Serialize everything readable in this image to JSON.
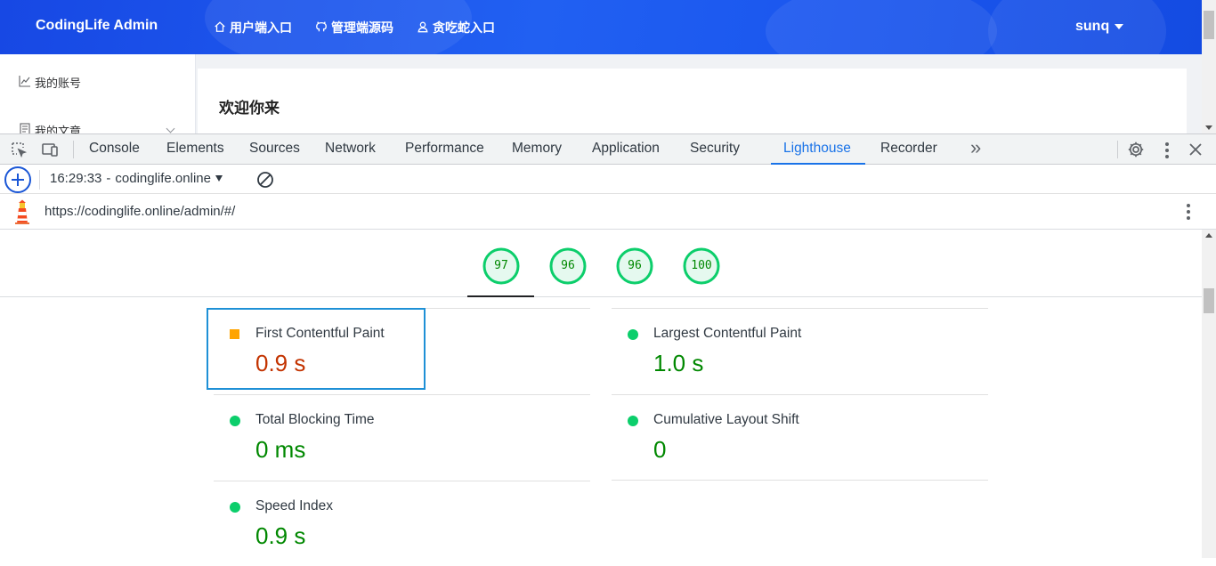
{
  "app": {
    "brand": "CodingLife Admin",
    "nav": [
      {
        "label": "用户端入口",
        "icon": "home-icon"
      },
      {
        "label": "管理端源码",
        "icon": "github-icon"
      },
      {
        "label": "贪吃蛇入口",
        "icon": "user-icon"
      }
    ],
    "user": "sunq",
    "sidebar": [
      {
        "label": "我的账号",
        "icon": "chart-line-icon"
      },
      {
        "label": "我的文章",
        "icon": "document-icon"
      }
    ],
    "welcome": "欢迎你来"
  },
  "devtools": {
    "tabs": [
      "Console",
      "Elements",
      "Sources",
      "Network",
      "Performance",
      "Memory",
      "Application",
      "Security",
      "Lighthouse",
      "Recorder"
    ],
    "active_tab": "Lighthouse",
    "more_tabs": "»",
    "report_time": "16:29:33",
    "report_host": "codinglife.online",
    "url": "https://codinglife.online/admin/#/",
    "scores": [
      "97",
      "96",
      "96",
      "100"
    ],
    "score_fractions": [
      0.97,
      0.96,
      0.96,
      1.0
    ],
    "colors": {
      "pass": "#0cce6b",
      "pass_text": "#008800",
      "average": "#ffa400",
      "average_text": "#c33300",
      "accent": "#1a73e8"
    },
    "metrics": [
      {
        "label": "First Contentful Paint",
        "value": "0.9 s",
        "rating": "average"
      },
      {
        "label": "Largest Contentful Paint",
        "value": "1.0 s",
        "rating": "pass"
      },
      {
        "label": "Total Blocking Time",
        "value": "0 ms",
        "rating": "pass"
      },
      {
        "label": "Cumulative Layout Shift",
        "value": "0",
        "rating": "pass"
      },
      {
        "label": "Speed Index",
        "value": "0.9 s",
        "rating": "pass"
      }
    ]
  }
}
